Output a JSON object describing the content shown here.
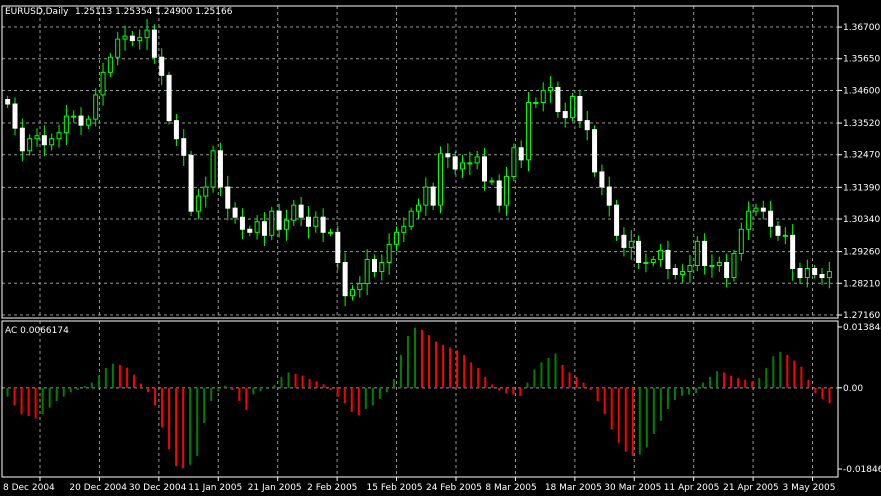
{
  "colors": {
    "background": "#000000",
    "grid": "#9a9a9a",
    "frame": "#ffffff",
    "text": "#ffffff",
    "bull": "#00ff00",
    "bear": "#ffffff",
    "wick": "#00ff00",
    "ac_up": "#008000",
    "ac_down": "#ff0000"
  },
  "chart_data": [
    {
      "type": "candlestick",
      "title": "EURUSD,Daily",
      "ohlc_label": "1.25113 1.25354 1.24900 1.25166",
      "ylim": [
        1.2716,
        1.37
      ],
      "y_ticks": [
        "1.36700",
        "1.35650",
        "1.34600",
        "1.33520",
        "1.32470",
        "1.31390",
        "1.30340",
        "1.29260",
        "1.28210",
        "1.27160"
      ],
      "x_ticks": [
        "8 Dec 2004",
        "20 Dec 2004",
        "30 Dec 2004",
        "11 Jan 2005",
        "21 Jan 2005",
        "2 Feb 2005",
        "15 Feb 2005",
        "24 Feb 2005",
        "8 Mar 2005",
        "18 Mar 2005",
        "30 Mar 2005",
        "11 Apr 2005",
        "21 Apr 2005",
        "3 May 2005"
      ],
      "close": [
        1.3415,
        1.3335,
        1.326,
        1.33,
        1.331,
        1.328,
        1.33,
        1.332,
        1.3375,
        1.3375,
        1.3345,
        1.3365,
        1.3445,
        1.352,
        1.357,
        1.363,
        1.364,
        1.3625,
        1.3635,
        1.366,
        1.357,
        1.351,
        1.336,
        1.33,
        1.3245,
        1.306,
        1.311,
        1.314,
        1.326,
        1.314,
        1.307,
        1.304,
        1.3,
        1.299,
        1.3025,
        1.298,
        1.306,
        1.3,
        1.303,
        1.308,
        1.304,
        1.301,
        1.304,
        1.299,
        1.299,
        1.289,
        1.278,
        1.28,
        1.282,
        1.29,
        1.286,
        1.289,
        1.295,
        1.299,
        1.301,
        1.306,
        1.308,
        1.314,
        1.308,
        1.325,
        1.324,
        1.32,
        1.322,
        1.322,
        1.324,
        1.316,
        1.316,
        1.308,
        1.3175,
        1.327,
        1.323,
        1.342,
        1.342,
        1.346,
        1.347,
        1.339,
        1.337,
        1.344,
        1.336,
        1.333,
        1.319,
        1.314,
        1.308,
        1.298,
        1.294,
        1.296,
        1.289,
        1.289,
        1.29,
        1.293,
        1.287,
        1.285,
        1.286,
        1.288,
        1.296,
        1.288,
        1.288,
        1.289,
        1.284,
        1.292,
        1.3,
        1.306,
        1.307,
        1.306,
        1.301,
        1.298,
        1.298,
        1.287,
        1.284,
        1.287,
        1.285,
        1.284,
        1.286
      ]
    },
    {
      "type": "bar",
      "title": "AC 0.0066174",
      "ylim": [
        -0.01846,
        0.01384
      ],
      "y_ticks": [
        "0.013844",
        "0.00",
        "-0.01846"
      ],
      "series": [
        {
          "name": "AC",
          "values": [
            -0.002,
            -0.004,
            -0.006,
            -0.0064,
            -0.007,
            -0.006,
            -0.0045,
            -0.003,
            -0.002,
            -0.001,
            -0.0005,
            0.0004,
            0.0012,
            0.0028,
            0.0045,
            0.0055,
            0.0052,
            0.0046,
            0.003,
            0.001,
            -0.001,
            -0.004,
            -0.009,
            -0.014,
            -0.0178,
            -0.0183,
            -0.0175,
            -0.0155,
            -0.008,
            -0.003,
            -0.0008,
            0.0005,
            -0.0005,
            -0.003,
            -0.005,
            -0.0015,
            -0.0008,
            -0.0003,
            0.0007,
            0.0025,
            0.0035,
            0.0032,
            0.0028,
            0.002,
            0.0015,
            0.0008,
            -0.0005,
            -0.002,
            -0.0035,
            -0.0055,
            -0.0062,
            -0.0048,
            -0.004,
            -0.0025,
            -0.001,
            0.002,
            0.0075,
            0.0118,
            0.0137,
            0.0132,
            0.012,
            0.0105,
            0.0098,
            0.0092,
            0.0085,
            0.0075,
            0.0058,
            0.0045,
            0.0025,
            0.0008,
            -0.0006,
            -0.0012,
            -0.0015,
            -0.0018,
            0.0012,
            0.0042,
            0.0058,
            0.0068,
            0.0078,
            0.0052,
            0.0035,
            0.0025,
            0.0012,
            -0.0005,
            -0.003,
            -0.006,
            -0.0095,
            -0.0125,
            -0.0145,
            -0.0155,
            -0.0152,
            -0.0135,
            -0.0105,
            -0.0075,
            -0.0048,
            -0.0028,
            -0.0018,
            -0.0015,
            -0.0012,
            0.0012,
            0.0025,
            0.0038,
            0.0035,
            0.0028,
            0.0022,
            0.0018,
            0.0014,
            0.0022,
            0.0045,
            0.0072,
            0.0082,
            0.0075,
            0.0062,
            0.0048,
            0.0018,
            -0.0012,
            -0.0025,
            -0.0035
          ]
        }
      ]
    }
  ]
}
